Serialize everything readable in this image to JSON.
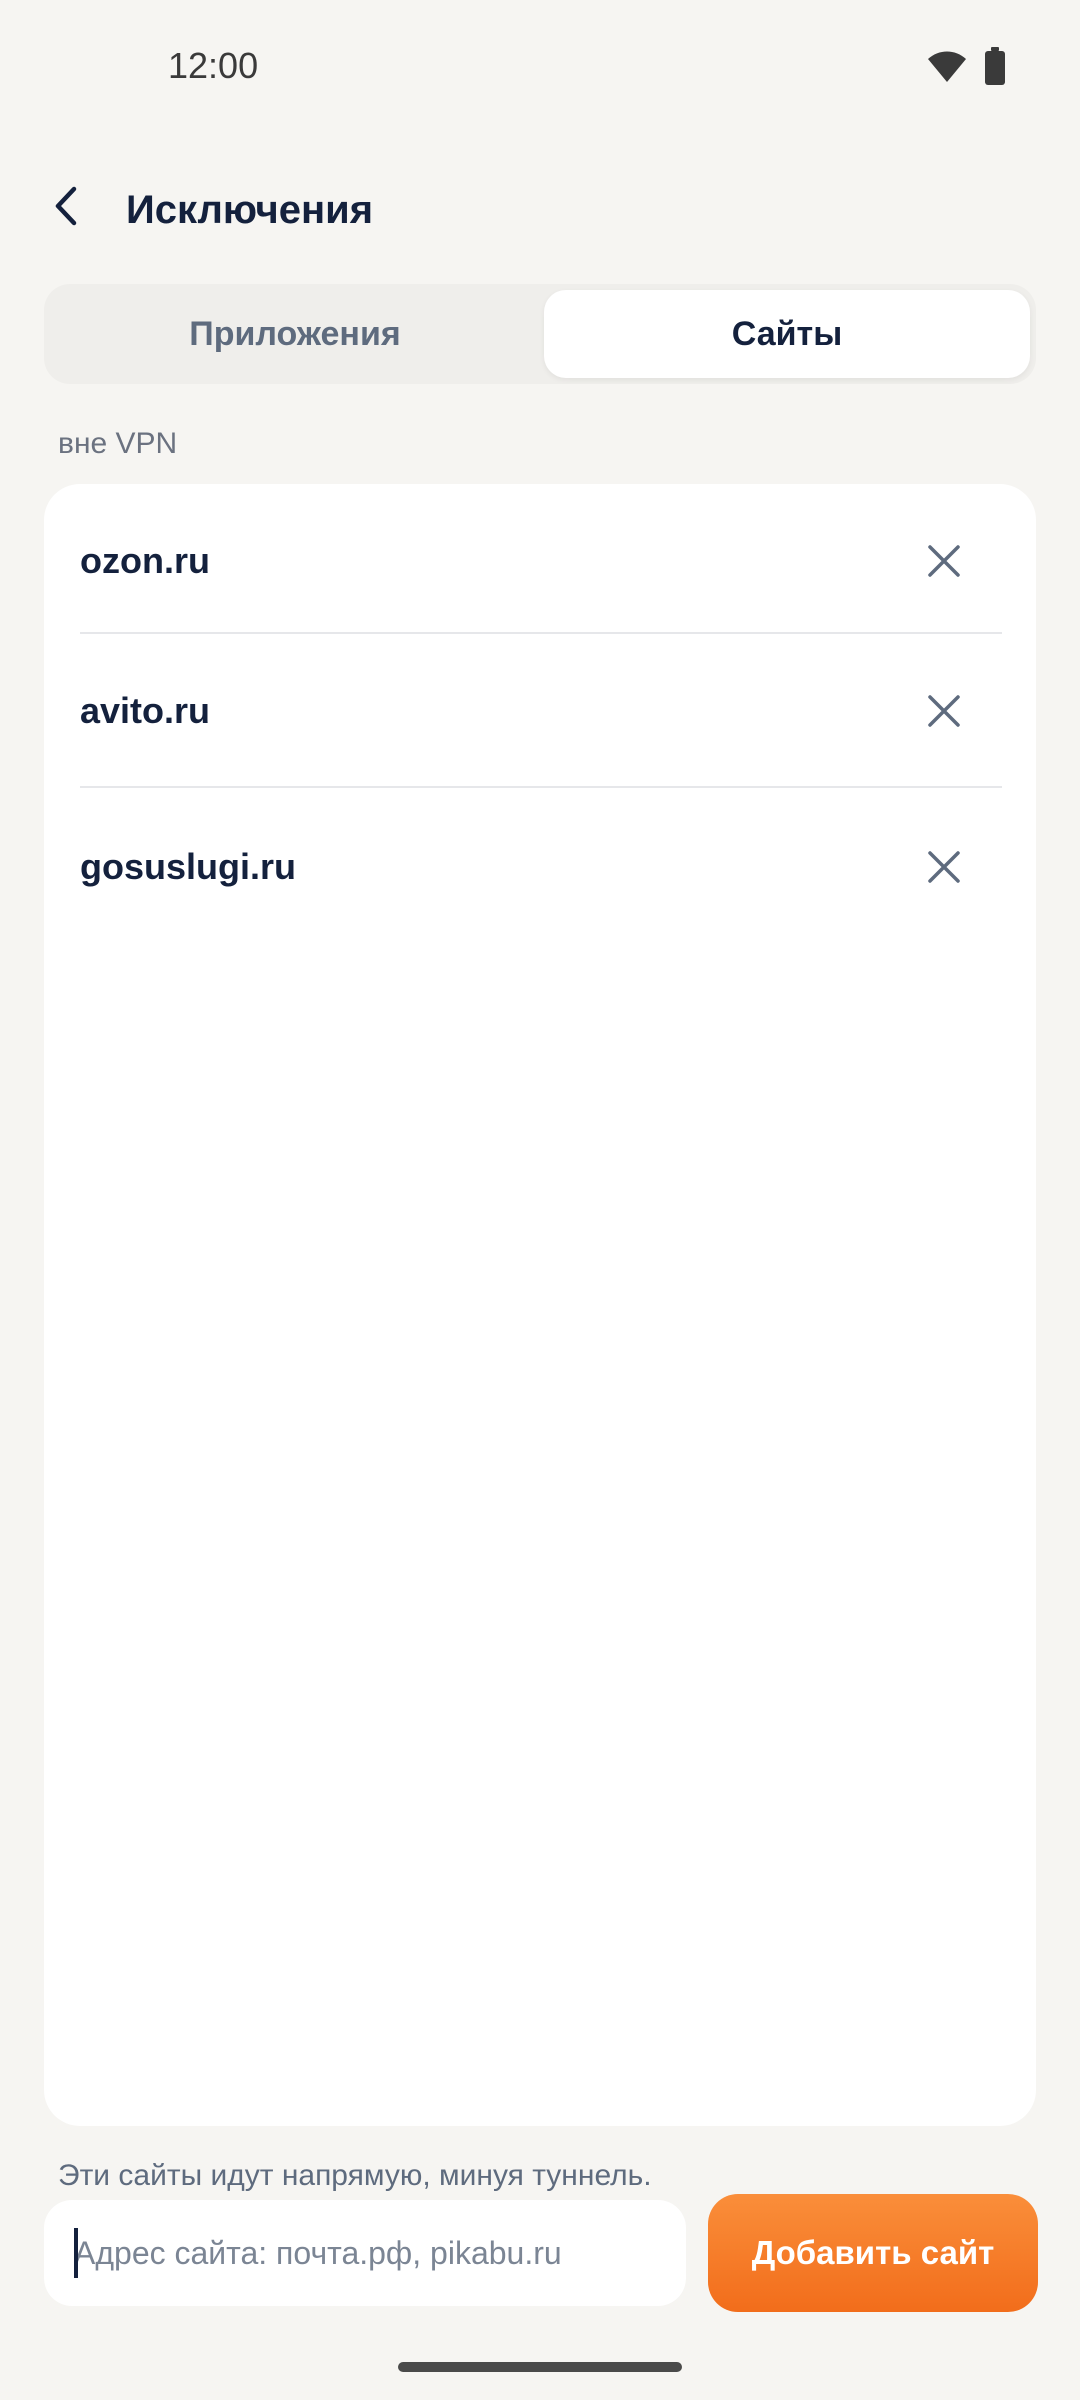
{
  "status_bar": {
    "time": "12:00",
    "icons": [
      "wifi-icon",
      "battery-icon"
    ]
  },
  "header": {
    "title": "Исключения",
    "back_icon": "chevron-left-icon"
  },
  "tabs": [
    {
      "label": "Приложения",
      "selected": false
    },
    {
      "label": "Сайты",
      "selected": true
    }
  ],
  "section_label": "вне VPN",
  "sites": [
    {
      "name": "ozon.ru",
      "remove_icon": "close-icon"
    },
    {
      "name": "avito.ru",
      "remove_icon": "close-icon"
    },
    {
      "name": "gosuslugi.ru",
      "remove_icon": "close-icon"
    }
  ],
  "footer_note": "Эти сайты идут напрямую, минуя туннель.",
  "add_site": {
    "input_value": "",
    "placeholder": "Адрес сайта: почта.рф, pikabu.ru",
    "button_label": "Добавить сайт"
  },
  "colors": {
    "background": "#F6F5F2",
    "accent": "#F47A24",
    "text_primary": "#14213D",
    "text_secondary": "#5E6B7E"
  }
}
